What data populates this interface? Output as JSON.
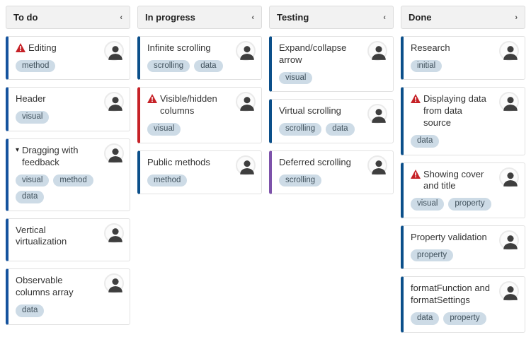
{
  "columns": [
    {
      "title": "To do",
      "chevron": "‹",
      "cards": [
        {
          "title": "Editing",
          "warning": true,
          "bar": "lb-blue",
          "tags": [
            "method"
          ]
        },
        {
          "title": "Header",
          "bar": "lb-blue",
          "tags": [
            "visual"
          ]
        },
        {
          "title": "Dragging with feedback",
          "caret": true,
          "bar": "lb-blue",
          "tags": [
            "visual",
            "method",
            "data"
          ]
        },
        {
          "title": "Vertical virtualization",
          "bar": "lb-blue",
          "tags": []
        },
        {
          "title": "Observable columns array",
          "bar": "lb-blue",
          "tags": [
            "data"
          ]
        }
      ]
    },
    {
      "title": "In progress",
      "chevron": "‹",
      "cards": [
        {
          "title": "Infinite scrolling",
          "bar": "lb-navy",
          "tags": [
            "scrolling",
            "data"
          ]
        },
        {
          "title": "Visible/hidden columns",
          "warning": true,
          "bar": "lb-red",
          "tags": [
            "visual"
          ]
        },
        {
          "title": "Public methods",
          "bar": "lb-navy",
          "tags": [
            "method"
          ]
        }
      ]
    },
    {
      "title": "Testing",
      "chevron": "‹",
      "cards": [
        {
          "title": "Expand/collapse arrow",
          "bar": "lb-navy",
          "tags": [
            "visual"
          ]
        },
        {
          "title": "Virtual scrolling",
          "bar": "lb-navy",
          "tags": [
            "scrolling",
            "data"
          ]
        },
        {
          "title": "Deferred scrolling",
          "bar": "lb-purple",
          "tags": [
            "scrolling"
          ]
        }
      ]
    },
    {
      "title": "Done",
      "chevron": "›",
      "cards": [
        {
          "title": "Research",
          "bar": "lb-navy",
          "tags": [
            "initial"
          ]
        },
        {
          "title": "Displaying data from data source",
          "warning": true,
          "bar": "lb-navy",
          "tags": [
            "data"
          ]
        },
        {
          "title": "Showing cover and title",
          "warning": true,
          "bar": "lb-navy",
          "tags": [
            "visual",
            "property"
          ]
        },
        {
          "title": "Property validation",
          "bar": "lb-navy",
          "tags": [
            "property"
          ]
        },
        {
          "title": "formatFunction and formatSettings",
          "bar": "lb-navy",
          "tags": [
            "data",
            "property"
          ]
        }
      ]
    }
  ]
}
